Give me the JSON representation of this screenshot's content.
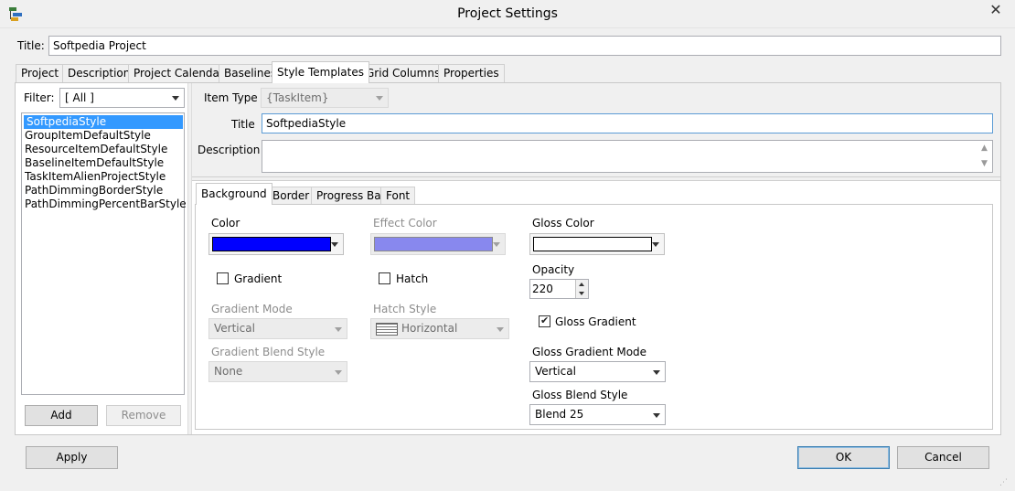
{
  "window": {
    "title": "Project Settings",
    "close_glyph": "✕",
    "icon": "project-tree-icon"
  },
  "title_field": {
    "label": "Title:",
    "value": "Softpedia Project"
  },
  "tabs": [
    {
      "label": "Project"
    },
    {
      "label": "Description"
    },
    {
      "label": "Project Calendar"
    },
    {
      "label": "Baselines"
    },
    {
      "label": "Style Templates",
      "active": true
    },
    {
      "label": "Grid Columns"
    },
    {
      "label": "Properties"
    }
  ],
  "left_panel": {
    "filter_label": "Filter:",
    "filter_value": "[ All ]",
    "styles": [
      {
        "label": "SoftpediaStyle",
        "selected": true
      },
      {
        "label": "GroupItemDefaultStyle"
      },
      {
        "label": "ResourceItemDefaultStyle"
      },
      {
        "label": "BaselineItemDefaultStyle"
      },
      {
        "label": "TaskItemAlienProjectStyle"
      },
      {
        "label": "PathDimmingBorderStyle"
      },
      {
        "label": "PathDimmingPercentBarStyle"
      }
    ],
    "add_label": "Add",
    "remove_label": "Remove"
  },
  "detail": {
    "item_type_label": "Item Type",
    "item_type_value": "{TaskItem}",
    "title_label": "Title",
    "title_value": "SoftpediaStyle",
    "description_label": "Description",
    "description_value": ""
  },
  "subtabs": [
    {
      "label": "Background",
      "active": true
    },
    {
      "label": "Border"
    },
    {
      "label": "Progress Bar"
    },
    {
      "label": "Font"
    }
  ],
  "background": {
    "color_label": "Color",
    "color_value": "#0000ff",
    "gradient_label": "Gradient",
    "gradient_checked": false,
    "gradient_mode_label": "Gradient Mode",
    "gradient_mode_value": "Vertical",
    "gradient_blend_label": "Gradient Blend Style",
    "gradient_blend_value": "None",
    "effect_color_label": "Effect Color",
    "effect_color_value": "#8888ee",
    "hatch_label": "Hatch",
    "hatch_checked": false,
    "hatch_style_label": "Hatch Style",
    "hatch_style_value": "Horizontal",
    "gloss_color_label": "Gloss Color",
    "gloss_color_value": "#ffffff",
    "opacity_label": "Opacity",
    "opacity_value": "220",
    "gloss_gradient_label": "Gloss Gradient",
    "gloss_gradient_checked": true,
    "gloss_gradient_mode_label": "Gloss Gradient Mode",
    "gloss_gradient_mode_value": "Vertical",
    "gloss_blend_label": "Gloss Blend Style",
    "gloss_blend_value": "Blend 25"
  },
  "footer": {
    "apply_label": "Apply",
    "ok_label": "OK",
    "cancel_label": "Cancel"
  }
}
